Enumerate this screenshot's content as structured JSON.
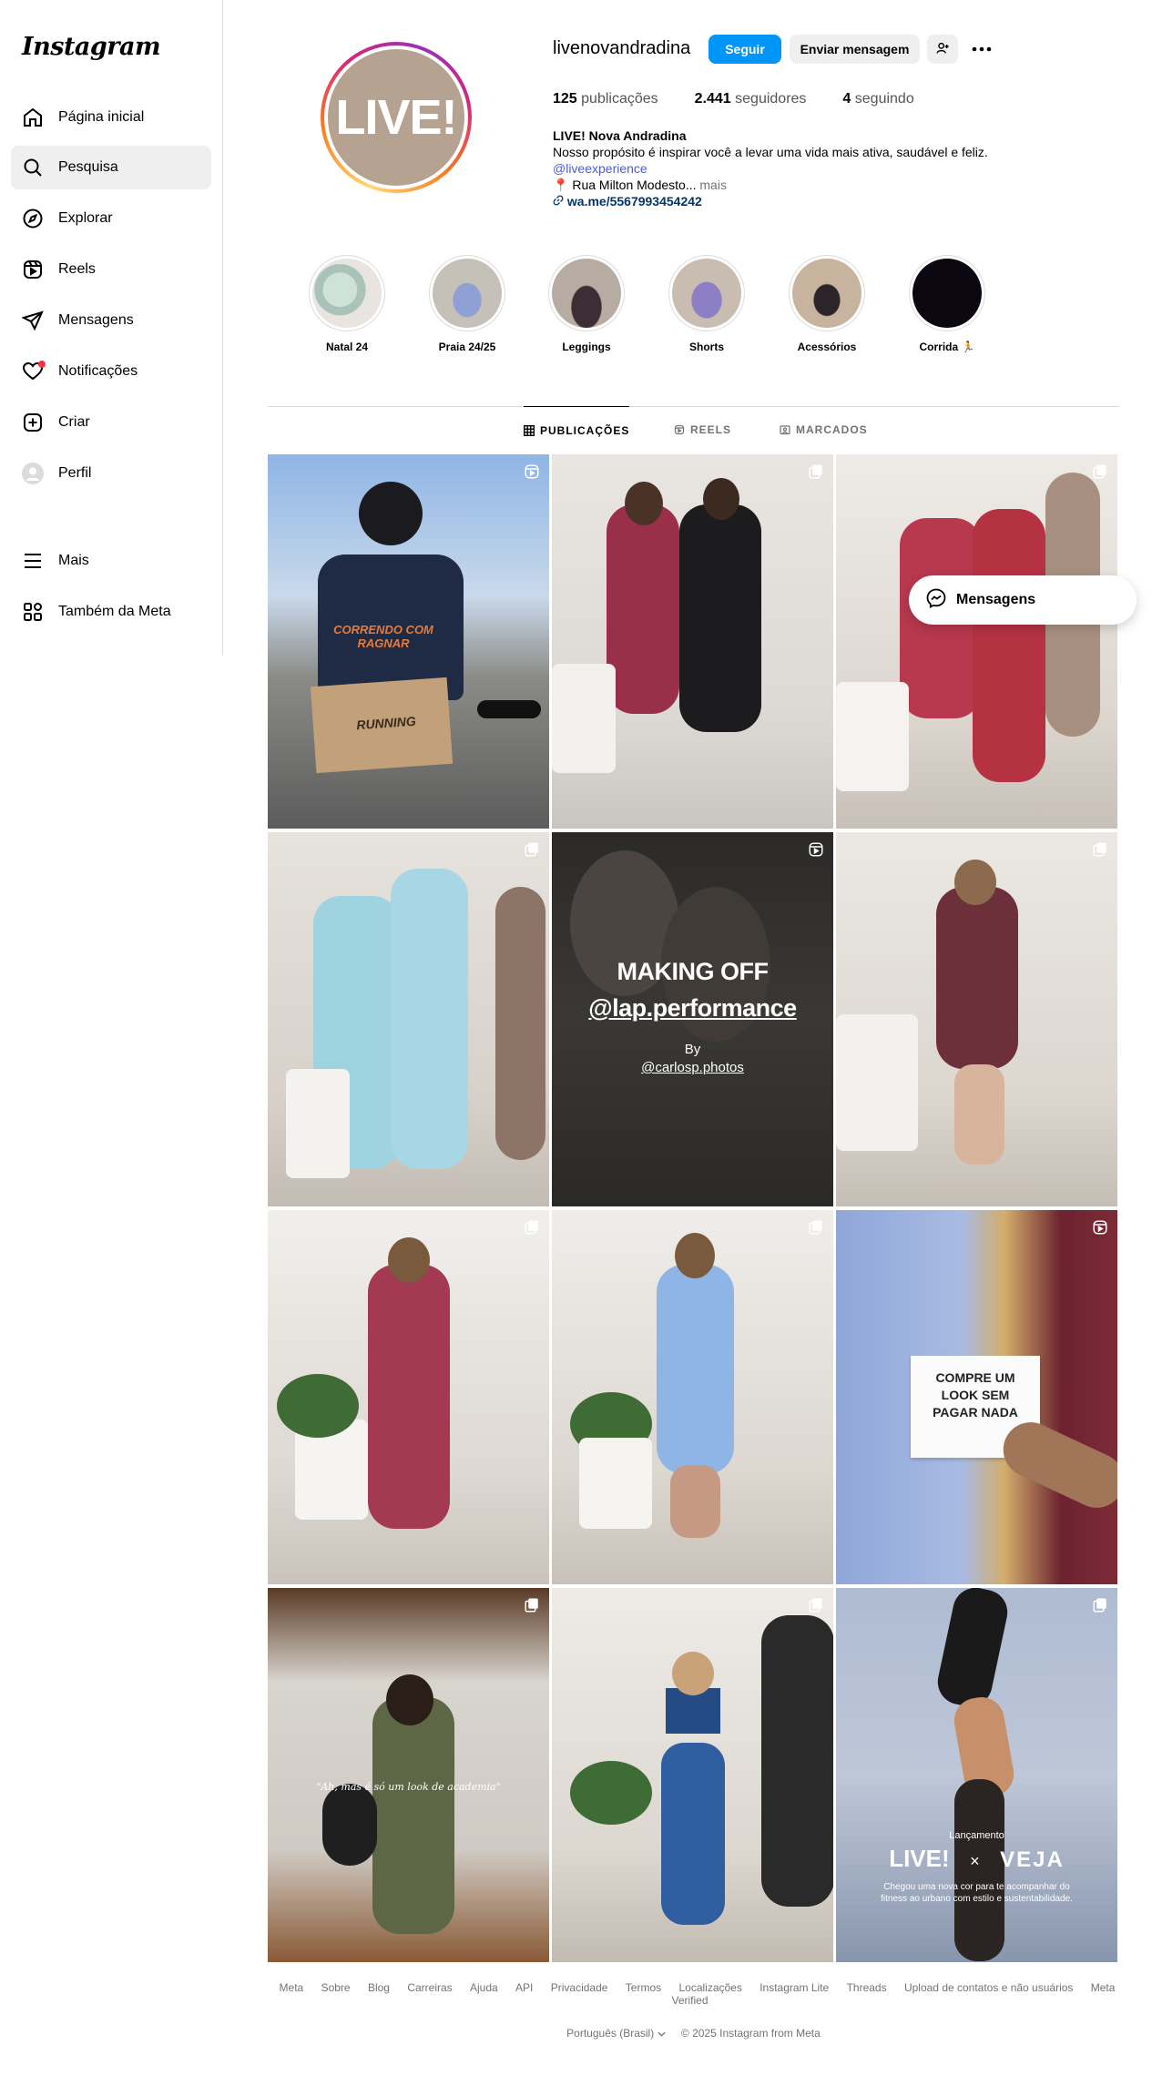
{
  "sidebar": {
    "logo": "Instagram",
    "items": [
      {
        "label": "Página inicial",
        "icon": "home-icon"
      },
      {
        "label": "Pesquisa",
        "icon": "search-icon"
      },
      {
        "label": "Explorar",
        "icon": "compass-icon"
      },
      {
        "label": "Reels",
        "icon": "reels-icon"
      },
      {
        "label": "Mensagens",
        "icon": "direct-icon"
      },
      {
        "label": "Notificações",
        "icon": "heart-icon"
      },
      {
        "label": "Criar",
        "icon": "plus-square-icon"
      },
      {
        "label": "Perfil",
        "icon": "profile-avatar"
      },
      {
        "label": "Mais",
        "icon": "menu-icon"
      },
      {
        "label": "Também da Meta",
        "icon": "meta-apps-icon"
      }
    ]
  },
  "profile": {
    "avatar_text": "LIVE!",
    "username": "livenovandradina",
    "follow_label": "Seguir",
    "message_label": "Enviar mensagem",
    "stats": {
      "posts_count": "125",
      "posts_label": " publicações",
      "followers_count": "2.441",
      "followers_label": " seguidores",
      "following_count": "4",
      "following_label": " seguindo"
    },
    "bio": {
      "name": "LIVE! Nova Andradina",
      "line1": "Nosso propósito é inspirar você a levar uma vida mais ativa, saudável e feliz.",
      "mention": "@liveexperience",
      "address_pin": "📍",
      "address": "Rua Milton Modesto...",
      "more": " mais",
      "url": "wa.me/5567993454242"
    }
  },
  "highlights": [
    {
      "label": "Natal 24"
    },
    {
      "label": "Praia 24/25"
    },
    {
      "label": "Leggings"
    },
    {
      "label": "Shorts"
    },
    {
      "label": "Acessórios"
    },
    {
      "label": "Corrida 🏃"
    }
  ],
  "tabs": [
    {
      "label": "PUBLICAÇÕES"
    },
    {
      "label": "REELS"
    },
    {
      "label": "MARCADOS"
    }
  ],
  "posts": {
    "p1_shirt": "CORRENDO COM RAGNAR",
    "p1_box": "RUNNING",
    "p5_title1": "MAKING OFF",
    "p5_title2": "@lap.performance",
    "p5_by": "By",
    "p5_credit": "@carlosp.photos",
    "p9_sign": "COMPRE UM LOOK SEM PAGAR NADA",
    "p10_quote": "\"Ah, mas é só um look de academia\"",
    "p12_small": "Lançamento",
    "p12_live": "LIVE!",
    "p12_x": "×",
    "p12_veja": "VEJA",
    "p12_text": "Chegou uma nova cor para te acompanhar do fitness ao urbano com estilo e sustentabilidade."
  },
  "floating": {
    "label": "Mensagens"
  },
  "footer": {
    "links": [
      "Meta",
      "Sobre",
      "Blog",
      "Carreiras",
      "Ajuda",
      "API",
      "Privacidade",
      "Termos",
      "Localizações",
      "Instagram Lite",
      "Threads",
      "Upload de contatos e não usuários",
      "Meta Verified"
    ],
    "language": "Português (Brasil)",
    "copyright": "© 2025 Instagram from Meta"
  }
}
